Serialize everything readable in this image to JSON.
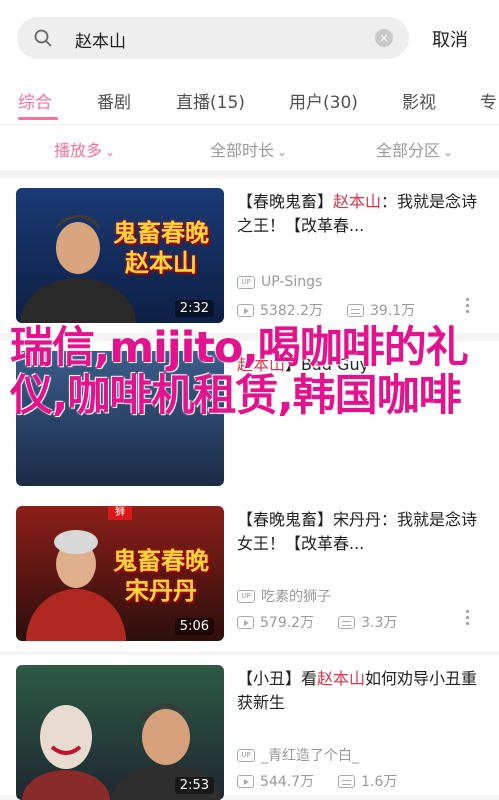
{
  "search": {
    "query": "赵本山",
    "cancel": "取消"
  },
  "tabs": [
    "综合",
    "番剧",
    "直播(15)",
    "用户(30)",
    "影视",
    "专"
  ],
  "filters": {
    "sort": "播放多",
    "duration": "全部时长",
    "zone": "全部分区"
  },
  "videos": [
    {
      "title_prefix": "【春晚鬼畜】",
      "title_highlight": "赵本山",
      "title_suffix": "：我就是念诗之王！【改革春...",
      "thumb_caption": "鬼畜春晚\n赵本山",
      "duration": "2:32",
      "uploader": "UP-Sings",
      "views": "5382.2万",
      "danmaku": "39.1万",
      "colors": {
        "bg_top": "#1b3a74",
        "bg_bottom": "#0d1f44"
      }
    },
    {
      "title_prefix": "",
      "title_highlight": "赵本山",
      "title_suffix": "】Bad Guy",
      "duration": "",
      "uploader": "",
      "views": "",
      "danmaku": ""
    },
    {
      "title_prefix": "【春晚鬼畜】",
      "title_highlight": "",
      "title_suffix": "宋丹丹：我就是念诗女王！【改革春...",
      "thumb_caption": "鬼畜春晚\n宋丹丹",
      "thumb_badge": "狮",
      "duration": "5:06",
      "uploader": "吃素的狮子",
      "views": "579.2万",
      "danmaku": "3.3万",
      "colors": {
        "bg_top": "#8c1f1a",
        "bg_bottom": "#2c0f0c"
      }
    },
    {
      "title_prefix": "【小丑】看",
      "title_highlight": "赵本山",
      "title_suffix": "如何劝导小丑重获新生",
      "duration": "2:53",
      "uploader": "_青红造了个白_",
      "views": "544.7万",
      "danmaku": "1.6万",
      "colors": {
        "bg_top": "#2d5a45",
        "bg_bottom": "#1f2730"
      }
    }
  ],
  "watermark": "瑞信,mijito,喝咖啡的礼仪,咖啡机租赁,韩国咖啡",
  "icon_labels": {
    "up": "UP"
  },
  "accent": "#fb7299"
}
